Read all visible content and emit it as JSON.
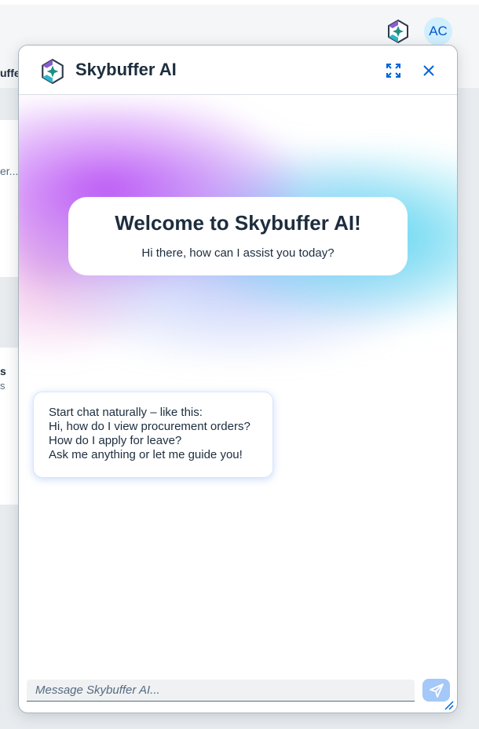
{
  "shell": {
    "avatar_initials": "AC",
    "ai_icon": "skybuffer-sparkle-icon"
  },
  "background": {
    "title_fragment": "uffe",
    "text_fragment_1": "er...",
    "text_fragment_2": "s",
    "text_fragment_3": "s"
  },
  "chat": {
    "title": "Skybuffer AI",
    "logo_icon": "skybuffer-sparkle-icon",
    "expand_icon": "expand-icon",
    "close_icon": "close-icon",
    "welcome": {
      "title": "Welcome to Skybuffer AI!",
      "subtitle": "Hi there, how can I assist you today?"
    },
    "bot_message": {
      "lines": [
        "Start chat naturally – like this:",
        "Hi, how do I view procurement orders?",
        "How do I apply for leave?",
        "Ask me anything or let me guide you!"
      ]
    },
    "input": {
      "placeholder": "Message Skybuffer AI...",
      "value": ""
    },
    "send_icon": "send-icon"
  },
  "colors": {
    "accent": "#0064d9",
    "send_button": "#a4c8f8",
    "glow_purple": "#b950f5",
    "glow_cyan": "#5ad7f0"
  }
}
